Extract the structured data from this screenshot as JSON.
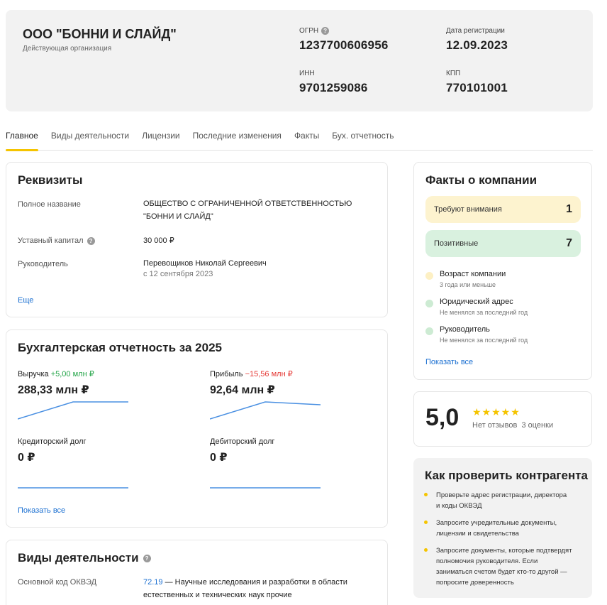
{
  "company": {
    "name": "ООО \"БОННИ И СЛАЙД\"",
    "status": "Действующая организация",
    "ogrn_label": "ОГРН",
    "ogrn": "1237700606956",
    "reg_date_label": "Дата регистрации",
    "reg_date": "12.09.2023",
    "inn_label": "ИНН",
    "inn": "9701259086",
    "kpp_label": "КПП",
    "kpp": "770101001"
  },
  "tabs": [
    {
      "label": "Главное",
      "active": true
    },
    {
      "label": "Виды деятельности",
      "active": false
    },
    {
      "label": "Лицензии",
      "active": false
    },
    {
      "label": "Последние изменения",
      "active": false
    },
    {
      "label": "Факты",
      "active": false
    },
    {
      "label": "Бух. отчетность",
      "active": false
    }
  ],
  "requisites": {
    "title": "Реквизиты",
    "full_name_label": "Полное название",
    "full_name_line1": "ОБЩЕСТВО С ОГРАНИЧЕННОЙ ОТВЕТСТВЕННОСТЬЮ",
    "full_name_line2": "\"БОННИ И СЛАЙД\"",
    "capital_label": "Уставный капитал",
    "capital": "30 000 ₽",
    "director_label": "Руководитель",
    "director": "Перевощиков Николай Сергеевич",
    "director_since": "с 12 сентября 2023",
    "more": "Еще"
  },
  "accounting": {
    "title": "Бухгалтерская отчетность за 2025",
    "revenue_label": "Выручка",
    "revenue_delta": "+5,00 млн ₽",
    "revenue": "288,33 млн ₽",
    "profit_label": "Прибыль",
    "profit_delta": "−15,56 млн ₽",
    "profit": "92,64 млн ₽",
    "creditor_label": "Кредиторский долг",
    "creditor": "0 ₽",
    "debtor_label": "Дебиторский долг",
    "debtor": "0 ₽",
    "show_all": "Показать все",
    "line_color": "#4a90e2"
  },
  "activities": {
    "title": "Виды деятельности",
    "main_code_label": "Основной код ОКВЭД",
    "code": "72.19",
    "desc_line1": " — Научные исследования и разработки в области",
    "desc_line2": "естественных и технических наук прочие"
  },
  "facts": {
    "title": "Факты о компании",
    "attention_label": "Требуют внимания",
    "attention_count": "1",
    "positive_label": "Позитивные",
    "positive_count": "7",
    "items": [
      {
        "title": "Возраст компании",
        "sub": "3 года или меньше",
        "color": "#fdf0c4"
      },
      {
        "title": "Юридический адрес",
        "sub": "Не менялся за последний год",
        "color": "#cdebd3"
      },
      {
        "title": "Руководитель",
        "sub": "Не менялся за последний год",
        "color": "#cdebd3"
      }
    ],
    "show_all": "Показать все",
    "attention_bg": "#fdf3cf",
    "positive_bg": "#d9f1df"
  },
  "rating": {
    "value": "5,0",
    "stars": "★★★★★",
    "no_reviews": "Нет отзывов",
    "ratings_count": "3 оценки"
  },
  "check": {
    "title": "Как проверить контрагента",
    "tip1_line1": "Проверьте адрес регистрации, директора",
    "tip1_line2": "и коды ОКВЭД",
    "tip2_line1": "Запросите учредительные документы,",
    "tip2_line2": "лицензии и свидетельства",
    "tip3_line1": "Запросите документы, которые подтвердят",
    "tip3_line2": "полномочия руководителя. Если",
    "tip3_line3": "заниматься счетом будет кто-то другой —",
    "tip3_line4": "попросите доверенность"
  }
}
